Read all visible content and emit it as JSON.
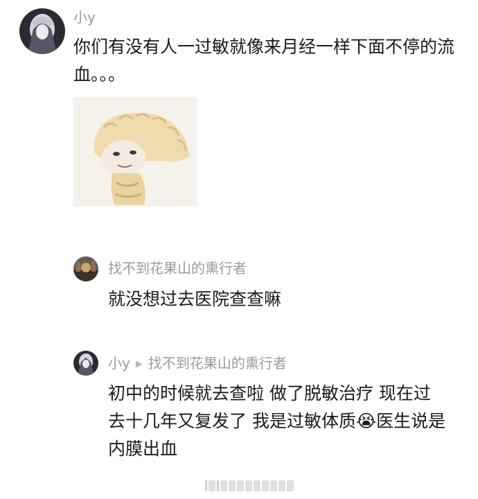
{
  "comment": {
    "username": "小y",
    "text": "你们有没有人一过敏就像来月经一样下面不停的流血。。。",
    "sticker": "dumpling-character-sticker"
  },
  "reply1": {
    "username": "找不到花果山的熏行者",
    "text": "就没想过去医院查查嘛"
  },
  "reply2": {
    "username": "小y",
    "reply_to": "找不到花果山的熏行者",
    "text_before_emoji": "初中的时候就去查啦 做了脱敏治疗 现在过去十几年又复发了 我是过敏体质",
    "emoji": "😭",
    "text_after_emoji": "医生说是内膜出血"
  },
  "icons": {
    "reply_arrow": "▶",
    "emoji": "loudly-crying-face-icon"
  },
  "colors": {
    "username": "#9a9a9a",
    "text": "#1a1a1a",
    "background": "#ffffff"
  }
}
